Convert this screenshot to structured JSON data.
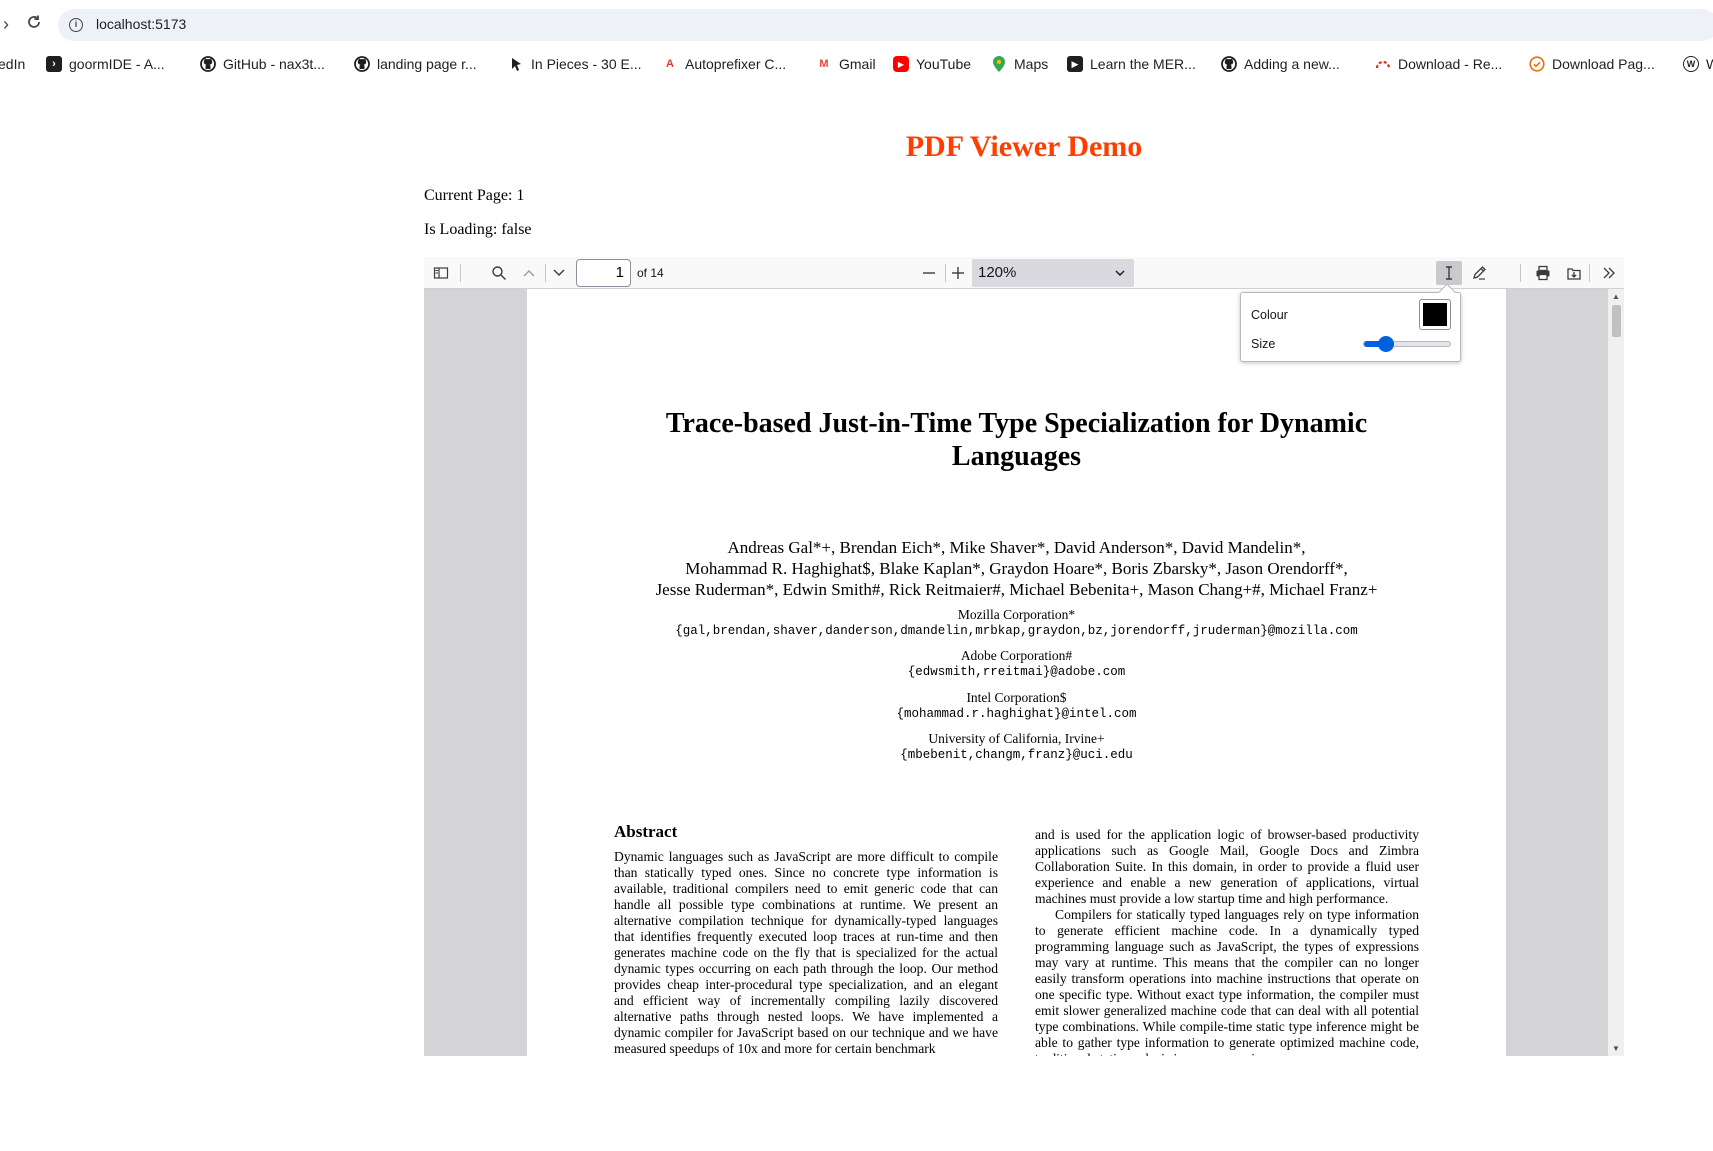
{
  "browser": {
    "url": "localhost:5173",
    "bookmarks": [
      {
        "label": "edIn",
        "icon": "linkedin-icon"
      },
      {
        "label": "goormIDE - A...",
        "icon": "terminal-icon"
      },
      {
        "label": "GitHub - nax3t...",
        "icon": "github-icon"
      },
      {
        "label": "landing page r...",
        "icon": "github-icon"
      },
      {
        "label": "In Pieces - 30 E...",
        "icon": "arrow-cursor-icon"
      },
      {
        "label": "Autoprefixer C...",
        "icon": "autoprefixer-icon"
      },
      {
        "label": "Gmail",
        "icon": "gmail-icon"
      },
      {
        "label": "YouTube",
        "icon": "youtube-icon"
      },
      {
        "label": "Maps",
        "icon": "maps-pin-icon"
      },
      {
        "label": "Learn the MER...",
        "icon": "course-icon"
      },
      {
        "label": "Adding a new...",
        "icon": "github-icon"
      },
      {
        "label": "Download - Re...",
        "icon": "redis-icon"
      },
      {
        "label": "Download Pag...",
        "icon": "check-circle-icon"
      },
      {
        "label": "W",
        "icon": "wordpress-icon"
      }
    ]
  },
  "page": {
    "title": "PDF Viewer Demo",
    "title_color": "#ff3e00",
    "current_page": "Current Page: 1",
    "is_loading": "Is Loading: false"
  },
  "viewer": {
    "page_number": "1",
    "page_count": "of 14",
    "zoom": "120%",
    "editor_popup": {
      "colour_label": "Colour",
      "colour_value": "#000000",
      "size_label": "Size",
      "size_level": 0.25
    }
  },
  "paper": {
    "title_line1": "Trace-based Just-in-Time Type Specialization for Dynamic",
    "title_line2": "Languages",
    "authors_line1": "Andreas Gal*+, Brendan Eich*, Mike Shaver*, David Anderson*, David Mandelin*,",
    "authors_line2": "Mohammad R. Haghighat$, Blake Kaplan*, Graydon Hoare*, Boris Zbarsky*, Jason Orendorff*,",
    "authors_line3": "Jesse Ruderman*, Edwin Smith#, Rick Reitmaier#, Michael Bebenita+, Mason Chang+#, Michael Franz+",
    "affiliations": [
      {
        "org": "Mozilla Corporation*",
        "email": "{gal,brendan,shaver,danderson,dmandelin,mrbkap,graydon,bz,jorendorff,jruderman}@mozilla.com"
      },
      {
        "org": "Adobe Corporation#",
        "email": "{edwsmith,rreitmai}@adobe.com"
      },
      {
        "org": "Intel Corporation$",
        "email": "{mohammad.r.haghighat}@intel.com"
      },
      {
        "org": "University of California, Irvine+",
        "email": "{mbebenit,changm,franz}@uci.edu"
      }
    ],
    "abstract_heading": "Abstract",
    "abstract_text": "Dynamic languages such as JavaScript are more difficult to compile than statically typed ones. Since no concrete type information is available, traditional compilers need to emit generic code that can handle all possible type combinations at runtime. We present an alternative compilation technique for dynamically-typed languages that identifies frequently executed loop traces at run-time and then generates machine code on the fly that is specialized for the actual dynamic types occurring on each path through the loop. Our method provides cheap inter-procedural type specialization, and an elegant and efficient way of incrementally compiling lazily discovered alternative paths through nested loops. We have implemented a dynamic compiler for JavaScript based on our technique and we have measured speedups of 10x and more for certain benchmark",
    "right_col_p1": "and is used for the application logic of browser-based productivity applications such as Google Mail, Google Docs and Zimbra Collaboration Suite. In this domain, in order to provide a fluid user experience and enable a new generation of applications, virtual machines must provide a low startup time and high performance.",
    "right_col_p2": "Compilers for statically typed languages rely on type information to generate efficient machine code. In a dynamically typed programming language such as JavaScript, the types of expressions may vary at runtime. This means that the compiler can no longer easily transform operations into machine instructions that operate on one specific type. Without exact type information, the compiler must emit slower generalized machine code that can deal with all potential type combinations. While compile-time static type inference might be able to gather type information to generate optimized machine code, traditional static analysis is very expensive"
  }
}
